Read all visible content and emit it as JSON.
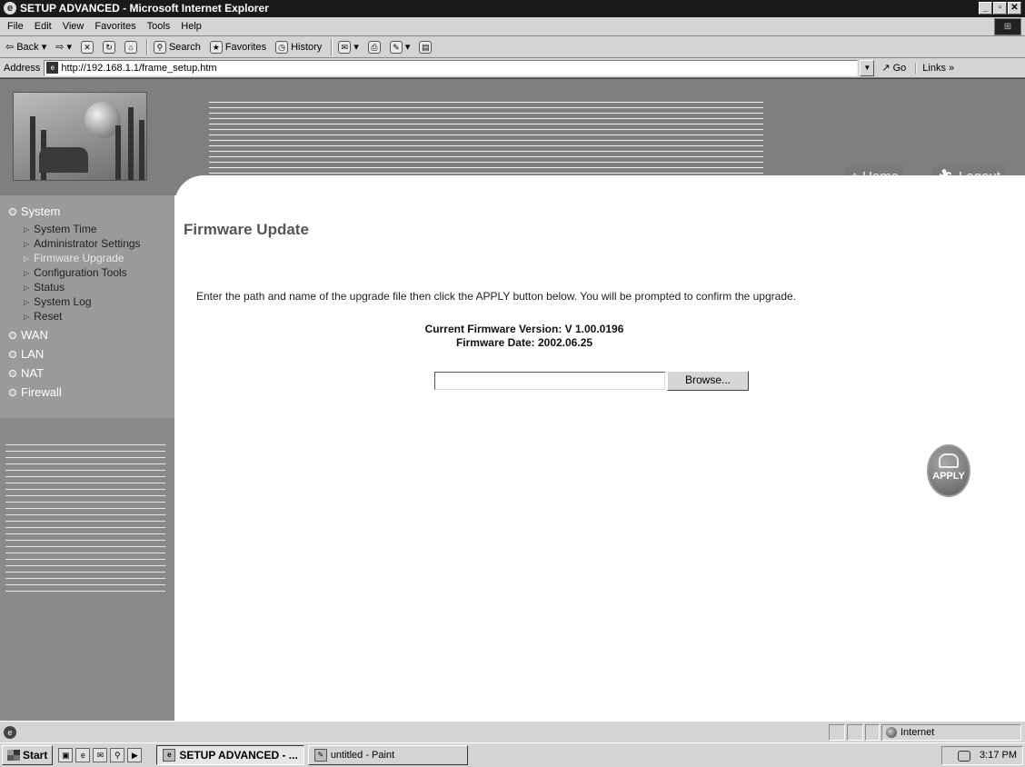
{
  "window": {
    "title": "SETUP ADVANCED - Microsoft Internet Explorer",
    "buttons": [
      "_",
      "▫",
      "✕"
    ]
  },
  "menubar": {
    "items": [
      "File",
      "Edit",
      "View",
      "Favorites",
      "Tools",
      "Help"
    ]
  },
  "toolbar": {
    "back": "Back",
    "search": "Search",
    "favorites": "Favorites",
    "history": "History"
  },
  "addressbar": {
    "label": "Address",
    "url": "http://192.168.1.1/frame_setup.htm",
    "go": "Go",
    "links": "Links »"
  },
  "header": {
    "home": "Home",
    "logout": "Logout"
  },
  "sidebar": {
    "categories": [
      {
        "label": "System"
      },
      {
        "label": "WAN"
      },
      {
        "label": "LAN"
      },
      {
        "label": "NAT"
      },
      {
        "label": "Firewall"
      }
    ],
    "system_items": [
      {
        "label": "System Time"
      },
      {
        "label": "Administrator Settings"
      },
      {
        "label": "Firmware Upgrade"
      },
      {
        "label": "Configuration Tools"
      },
      {
        "label": "Status"
      },
      {
        "label": "System Log"
      },
      {
        "label": "Reset"
      }
    ]
  },
  "content": {
    "title": "Firmware Update",
    "instructions": "Enter the path and name of the upgrade file then click the APPLY button below. You will be prompted to confirm the upgrade.",
    "firmware_version": "Current Firmware Version: V 1.00.0196",
    "firmware_date": "Firmware Date:  2002.06.25",
    "file_value": "",
    "browse_label": "Browse...",
    "apply_label": "APPLY"
  },
  "statusbar": {
    "zone": "Internet"
  },
  "taskbar": {
    "start": "Start",
    "tasks": [
      {
        "label": "SETUP ADVANCED - ..."
      },
      {
        "label": "untitled - Paint"
      }
    ],
    "clock": "3:17 PM"
  }
}
